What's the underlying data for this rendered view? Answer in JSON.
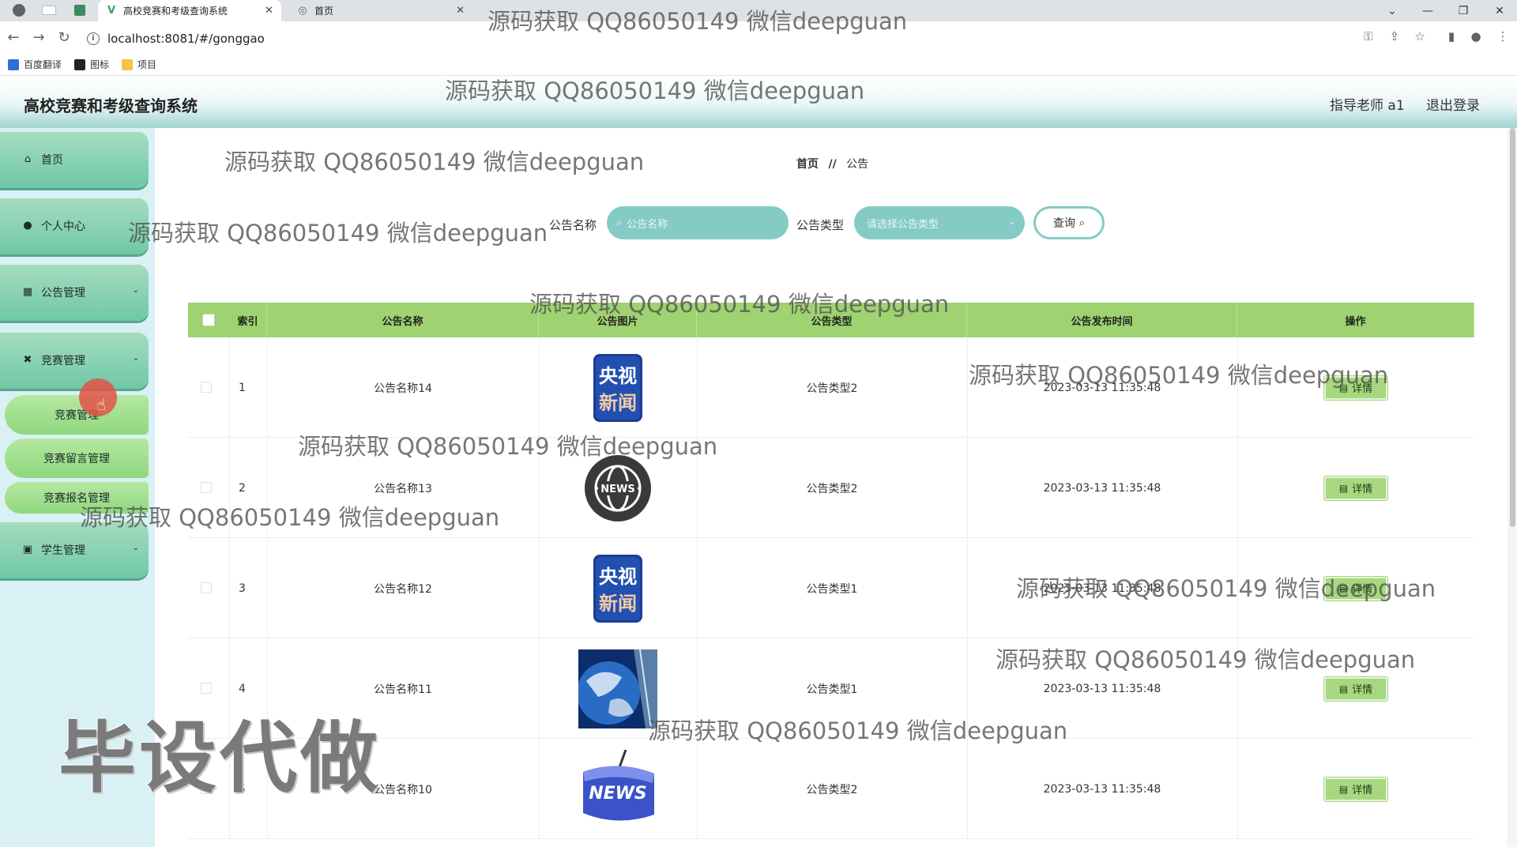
{
  "browser": {
    "tabs": [
      {
        "title": "高校竞赛和考级查询系统",
        "active": true
      },
      {
        "title": "首页",
        "active": false
      }
    ],
    "url": "localhost:8081/#/gonggao",
    "bookmarks": [
      "百度翻译",
      "图标",
      "项目"
    ]
  },
  "header": {
    "title": "高校竞赛和考级查询系统",
    "user": "指导老师 a1",
    "logout": "退出登录"
  },
  "sidebar": {
    "items": [
      {
        "label": "首页",
        "icon": "home-icon"
      },
      {
        "label": "个人中心",
        "icon": "user-icon"
      },
      {
        "label": "公告管理",
        "icon": "grid-icon"
      },
      {
        "label": "竞赛管理",
        "icon": "trophy-icon"
      },
      {
        "label": "学生管理",
        "icon": "clipboard-icon"
      }
    ],
    "subitems": [
      "竞赛管理",
      "竞赛留言管理",
      "竞赛报名管理"
    ]
  },
  "breadcrumb": {
    "home": "首页",
    "sep": "//",
    "current": "公告"
  },
  "search": {
    "name_label": "公告名称",
    "name_placeholder": "公告名称",
    "type_label": "公告类型",
    "type_placeholder": "请选择公告类型",
    "query_button": "查询"
  },
  "table": {
    "columns": [
      "索引",
      "公告名称",
      "公告图片",
      "公告类型",
      "公告发布时间",
      "操作"
    ],
    "detail_label": "详情",
    "rows": [
      {
        "index": "1",
        "name": "公告名称14",
        "image": "cctv-news-logo",
        "type": "公告类型2",
        "time": "2023-03-13 11:35:48"
      },
      {
        "index": "2",
        "name": "公告名称13",
        "image": "globe-news-logo",
        "type": "公告类型2",
        "time": "2023-03-13 11:35:48"
      },
      {
        "index": "3",
        "name": "公告名称12",
        "image": "cctv-news-logo",
        "type": "公告类型1",
        "time": "2023-03-13 11:35:48"
      },
      {
        "index": "4",
        "name": "公告名称11",
        "image": "globe-photo",
        "type": "公告类型1",
        "time": "2023-03-13 11:35:48"
      },
      {
        "index": "5",
        "name": "公告名称10",
        "image": "news-key",
        "type": "公告类型2",
        "time": "2023-03-13 11:35:48"
      }
    ]
  },
  "watermark": {
    "text": "源码获取 QQ86050149 微信deepguan",
    "big": "毕设代做"
  },
  "cctv_logo": {
    "top": "央视",
    "bottom": "新闻"
  },
  "news_word": "NEWS",
  "colors": {
    "accent_teal": "#85cbc5",
    "menu_green": "#6fc8a7",
    "header_green": "#9fd270",
    "sidebar_bg": "#d9f1f5"
  }
}
